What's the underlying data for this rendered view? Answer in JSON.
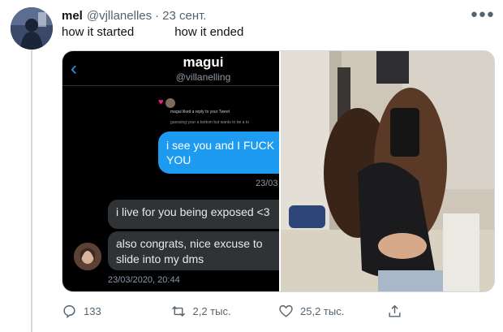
{
  "author": {
    "name": "mel",
    "handle": "@vjllanelles",
    "separator": "·",
    "date": "23 сент."
  },
  "tweet": {
    "text": "how it started            how it ended"
  },
  "dm": {
    "back_icon": "chevron-left-icon",
    "name": "magui",
    "handle": "@villanelling",
    "notification": "magui liked a reply to your Tweet",
    "notification_sub": "guessing your a bottom but wants to be a to",
    "sent_message": "i see you and I FUCK YOU",
    "sent_timestamp": "23/03",
    "received": [
      "i live for you being exposed <3",
      "also congrats, nice excuse to slide into my dms"
    ],
    "received_timestamp": "23/03/2020, 20:44"
  },
  "actions": {
    "reply_count": "133",
    "retweet_count": "2,2 тыс.",
    "like_count": "25,2 тыс."
  },
  "colors": {
    "accent": "#1d9bf0",
    "dm_background": "#000000",
    "received_bubble": "#2f3336",
    "secondary_text": "#536471"
  }
}
